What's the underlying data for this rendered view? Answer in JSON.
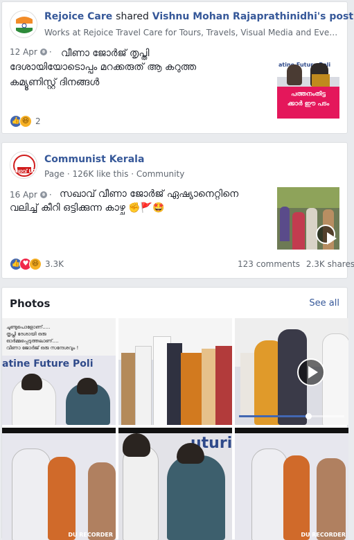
{
  "post1": {
    "page_name": "Rejoice Care",
    "action": "shared",
    "shared_from": "Vishnu Mohan Rajaprathinidhi's post",
    "subtitle": "Works at Rejoice Travel Care for Tours, Travels, Visual Media and Event Man...",
    "date": "12 Apr",
    "text_line1": "വീണാ ജോർജ് തൃപ്തി",
    "text_line2": "ദേശായിയോടൊപ്പം മറക്കരുത് ആ കറുത്ത",
    "text_line3": "കമ്യൂണിസ്റ്റ് ദിനങ്ങൾ",
    "thumb_banner": "പത്തനംതിട്ട",
    "thumb_banner2": "ക്കാർ ഈ പടം",
    "thumb_stage_text": "atine Future Poli",
    "reaction_count": "2"
  },
  "post2": {
    "page_name": "Communist Kerala",
    "meta_type": "Page",
    "likes": "126K like this",
    "category": "Community",
    "date": "16 Apr",
    "text_line1": "സഖാവ് വീണാ ജോർജ് ഏഷ്യാനെറ്റിനെ",
    "text_line2": "വലിച്ച് കീറി ഒട്ടിക്കുന്ന കാഴ്ച ✊🚩🤩",
    "avatar_text": "സഖാവ് LDF",
    "reaction_count": "3.3K",
    "comments": "123 comments",
    "shares": "2.3K shares"
  },
  "photos": {
    "title": "Photos",
    "see_all": "See all",
    "caption_lines": [
      "ചുണ്ടുപൊളോണ്.....",
      "തൃപ്തി ദേശായി ഒരു",
      "ഓർമ്മപ്പെടുത്തലാണ്....",
      "വീണാ ജോർജ് ഒരു സന്ദേശവും !"
    ],
    "stage_text": "atine Future Poli",
    "stage_text2": "uturi",
    "watermark": "DU RECORDER"
  },
  "colors": {
    "link": "#365899",
    "like": "#4267b2",
    "love": "#f0284a",
    "haha": "#f7b125",
    "banner": "#e4175b"
  }
}
